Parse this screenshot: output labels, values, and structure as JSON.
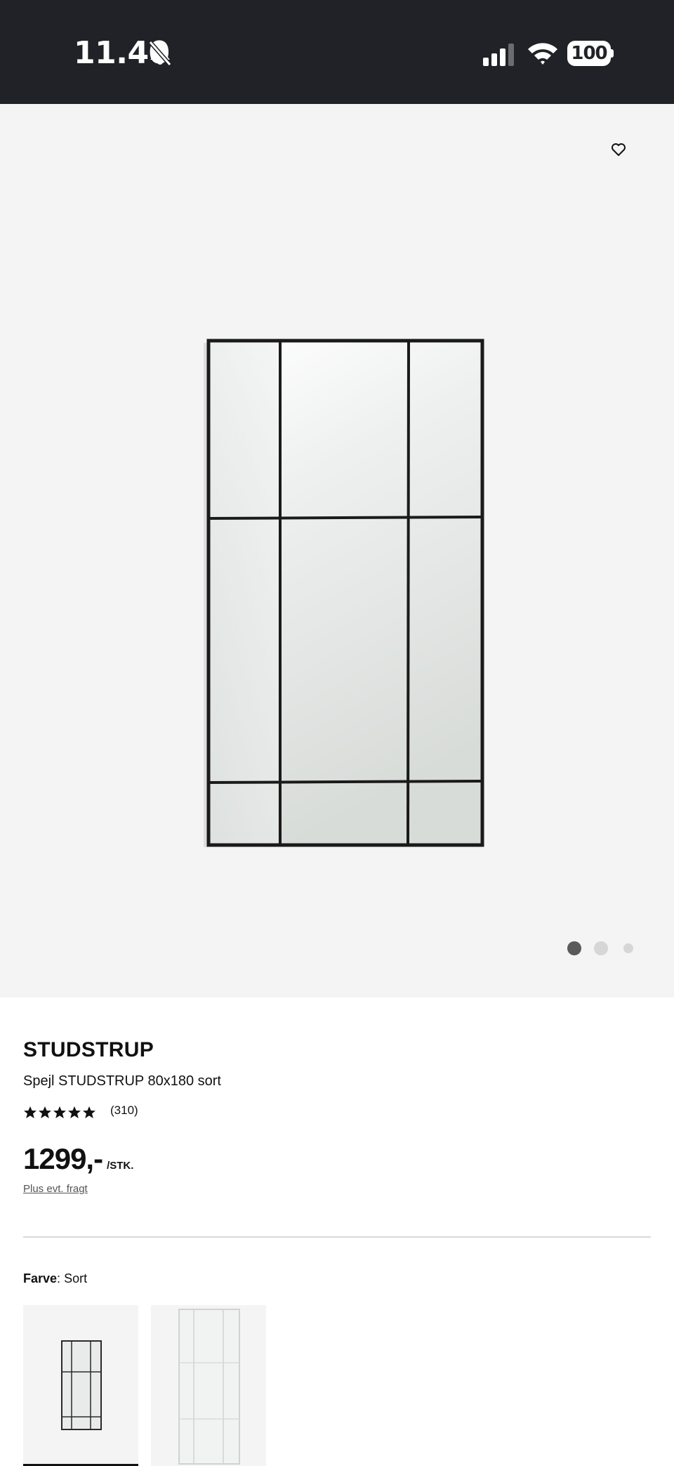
{
  "status_bar": {
    "time": "11.40",
    "battery": "100",
    "icons": [
      "bell-slash-icon",
      "signal-icon",
      "wifi-icon",
      "battery-icon"
    ]
  },
  "gallery": {
    "favorite_icon": "heart-outline-icon",
    "dots_count": 3,
    "active_dot": 1
  },
  "product": {
    "brand": "STUDSTRUP",
    "description": "Spejl STUDSTRUP 80x180 sort",
    "rating_stars": 5,
    "review_count": "(310)",
    "price": "1299,-",
    "unit": "/STK.",
    "shipping_link": "Plus evt. fragt"
  },
  "color": {
    "label": "Farve",
    "separator": ": ",
    "value": "Sort",
    "variants": [
      {
        "name": "sort",
        "selected": true
      },
      {
        "name": "aluminium",
        "selected": false
      }
    ]
  },
  "colors": {
    "status_bar_bg": "#212227",
    "gallery_bg": "#f4f4f4",
    "text": "#111111",
    "dot_active": "#5a5a5a",
    "dot_inactive": "#d6d6d6"
  }
}
